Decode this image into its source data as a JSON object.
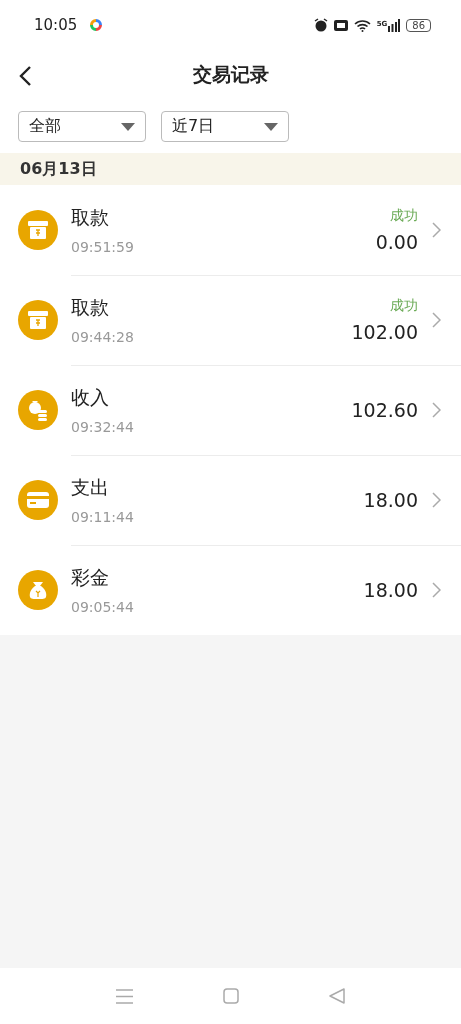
{
  "status_bar": {
    "time": "10:05",
    "network": "5G",
    "battery": "86"
  },
  "header": {
    "title": "交易记录"
  },
  "filters": [
    {
      "label": "全部"
    },
    {
      "label": "近7日"
    }
  ],
  "date": "06月13日",
  "transactions": [
    {
      "kind": "withdraw",
      "title": "取款",
      "time": "09:51:59",
      "status": "成功",
      "amount": "0.00"
    },
    {
      "kind": "withdraw",
      "title": "取款",
      "time": "09:44:28",
      "status": "成功",
      "amount": "102.00"
    },
    {
      "kind": "income",
      "title": "收入",
      "time": "09:32:44",
      "amount": "102.60"
    },
    {
      "kind": "expense",
      "title": "支出",
      "time": "09:11:44",
      "amount": "18.00"
    },
    {
      "kind": "bonus",
      "title": "彩金",
      "time": "09:05:44",
      "amount": "18.00"
    }
  ]
}
